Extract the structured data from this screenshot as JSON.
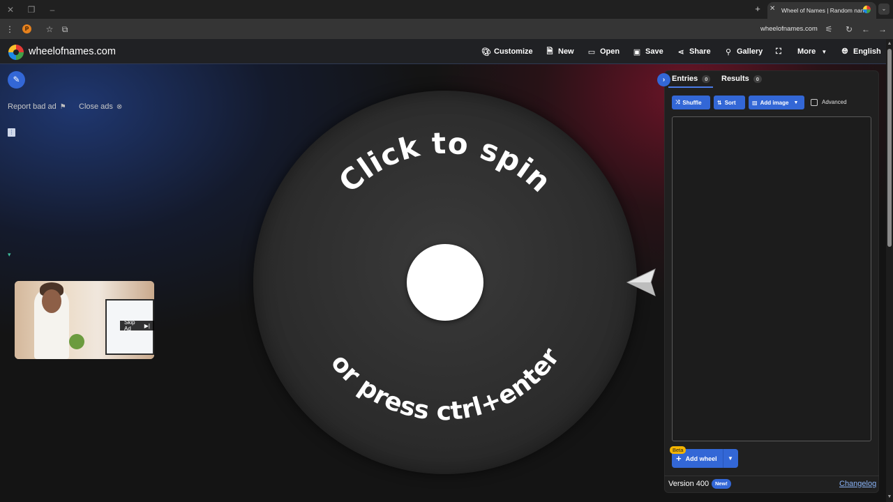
{
  "browser": {
    "tab_title": "Wheel of Names | Random name",
    "url": "wheelofnames.com",
    "ext_letter": "P"
  },
  "header": {
    "site_name": "wheelofnames.com",
    "menu": [
      {
        "label": "Customize",
        "icon": "palette-icon"
      },
      {
        "label": "New",
        "icon": "file-icon"
      },
      {
        "label": "Open",
        "icon": "folder-open-icon"
      },
      {
        "label": "Save",
        "icon": "floppy-icon"
      },
      {
        "label": "Share",
        "icon": "share-icon"
      },
      {
        "label": "Gallery",
        "icon": "search-icon"
      },
      {
        "label": "",
        "icon": "fullscreen-icon"
      },
      {
        "label": "More",
        "icon": "chevron-down-icon"
      },
      {
        "label": "English",
        "icon": "globe-icon"
      }
    ]
  },
  "ads": {
    "report_label": "Report bad ad",
    "close_label": "Close ads",
    "skip_label": "Skip Ad"
  },
  "wheel": {
    "top_text": "Click to spin",
    "bottom_text": "or press ctrl+enter"
  },
  "panel": {
    "tabs": [
      {
        "label": "Entries",
        "count": "0"
      },
      {
        "label": "Results",
        "count": "0"
      }
    ],
    "toolbar": {
      "shuffle": "Shuffle",
      "sort": "Sort",
      "add_image": "Add image",
      "advanced": "Advanced"
    },
    "add_wheel": "Add wheel",
    "beta": "Beta",
    "version": "Version 400",
    "new_badge": "New!",
    "changelog": "Changelog"
  },
  "colors": {
    "accent": "#3367d6",
    "beta": "#f4b400",
    "link": "#8ab4f8"
  }
}
